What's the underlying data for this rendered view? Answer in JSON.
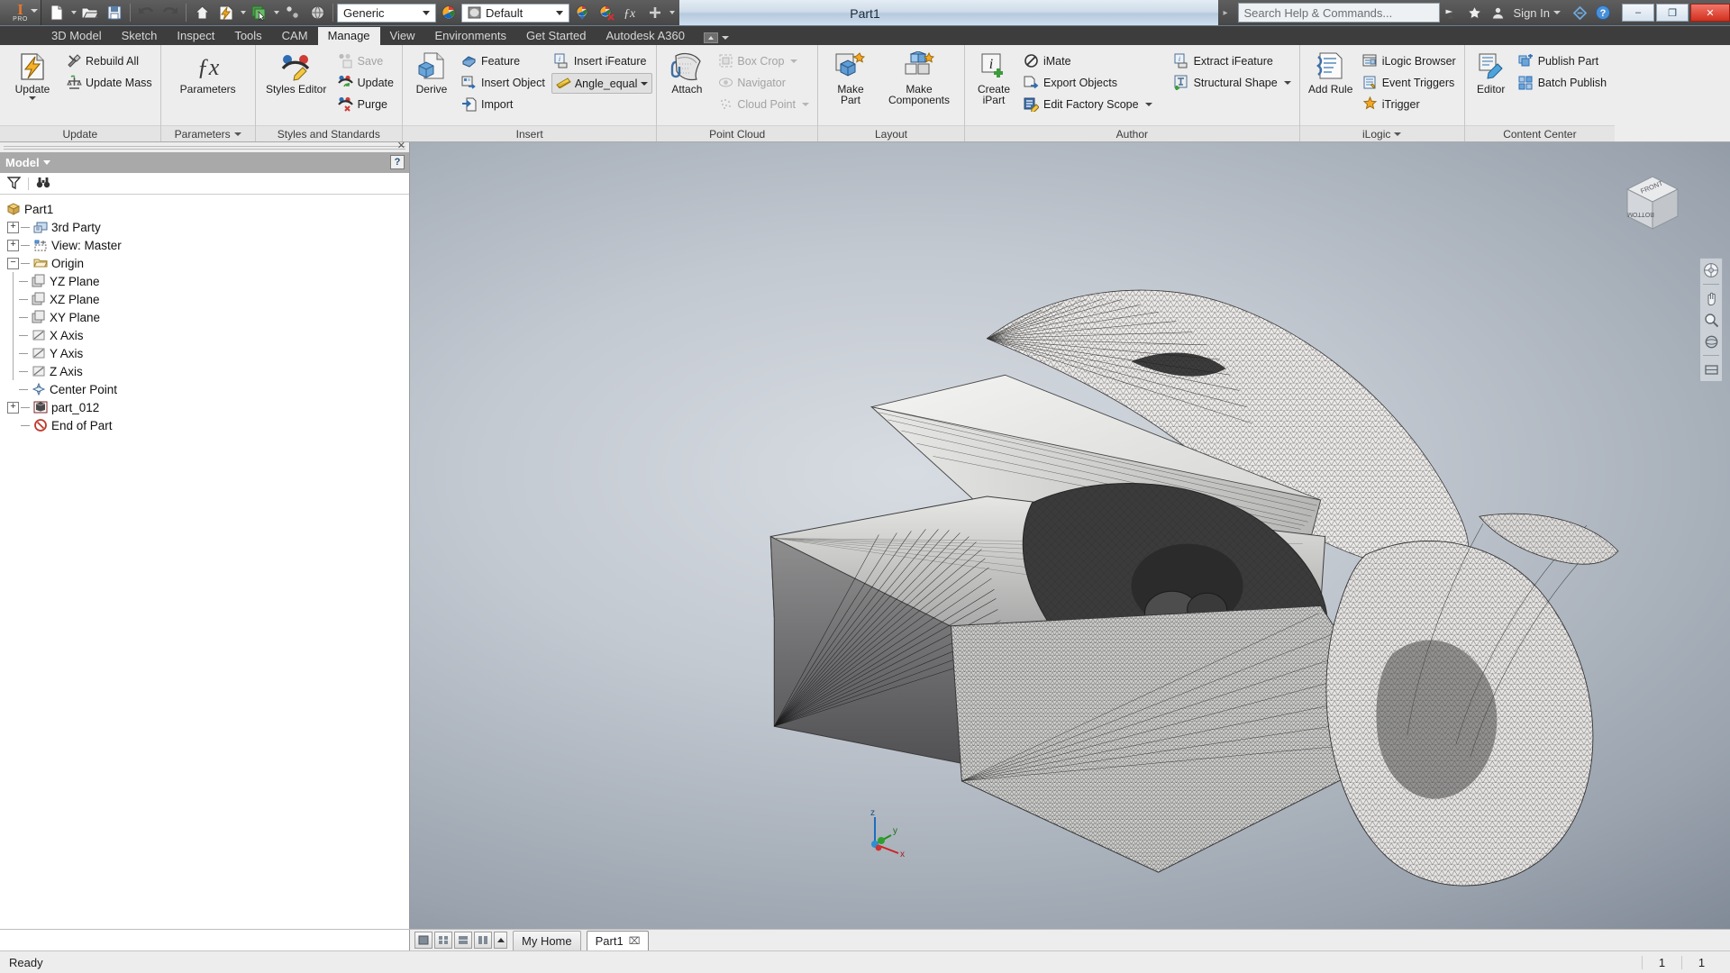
{
  "app": {
    "logo_text": "I",
    "logo_sub": "PRO",
    "title": "Part1"
  },
  "quick_access": {
    "items": [
      {
        "name": "new-document-button",
        "icon": "new-file-icon",
        "caret": true
      },
      {
        "name": "open-document-button",
        "icon": "open-folder-icon",
        "caret": false
      },
      {
        "name": "save-document-button",
        "icon": "floppy-save-icon",
        "caret": false
      },
      {
        "name": "undo-button",
        "icon": "undo-arrow-icon",
        "caret": false
      },
      {
        "name": "redo-button",
        "icon": "redo-arrow-icon",
        "caret": false
      },
      {
        "name": "home-button",
        "icon": "home-icon",
        "caret": false
      },
      {
        "name": "update-button",
        "icon": "lightning-update-icon",
        "caret": true
      },
      {
        "name": "select-button",
        "icon": "select-green-icon",
        "caret": true
      },
      {
        "name": "return-button",
        "icon": "return-node-icon",
        "caret": false
      },
      {
        "name": "appearance-sphere-button",
        "icon": "globe-sphere-icon",
        "caret": false
      }
    ],
    "material_combo": "Generic",
    "appearance_combo": "Default",
    "extra": [
      {
        "name": "adjust-appearance-button",
        "icon": "appearance-adjust-icon"
      },
      {
        "name": "clear-appearance-button",
        "icon": "appearance-clear-icon"
      },
      {
        "name": "parameters-fx-button",
        "icon": "fx-icon"
      },
      {
        "name": "customize-qat-button",
        "icon": "plus-icon",
        "caret": true
      }
    ]
  },
  "titlebar_right": {
    "search_placeholder": "Search Help & Commands...",
    "signin_label": "Sign In",
    "icons": [
      {
        "name": "autodesk-exchange-icon"
      },
      {
        "name": "favorites-star-icon"
      },
      {
        "name": "user-account-icon"
      },
      {
        "name": "exchange-apps-icon"
      },
      {
        "name": "help-question-icon"
      }
    ],
    "window_controls": {
      "minimize": "–",
      "maximize": "❐",
      "close": "✕"
    }
  },
  "ribbon_tabs": {
    "items": [
      {
        "label": "3D Model",
        "active": false
      },
      {
        "label": "Sketch",
        "active": false
      },
      {
        "label": "Inspect",
        "active": false
      },
      {
        "label": "Tools",
        "active": false
      },
      {
        "label": "CAM",
        "active": false
      },
      {
        "label": "Manage",
        "active": true
      },
      {
        "label": "View",
        "active": false
      },
      {
        "label": "Environments",
        "active": false
      },
      {
        "label": "Get Started",
        "active": false
      },
      {
        "label": "Autodesk A360",
        "active": false
      }
    ]
  },
  "ribbon_panels": [
    {
      "title": "Update",
      "has_caret": false,
      "big_buttons": [
        {
          "label_line1": "Update",
          "label_line2": "",
          "icon": "update-lightning-icon",
          "has_dropdown": true
        }
      ],
      "small_buttons": [
        {
          "label": "Rebuild All",
          "icon": "rebuild-tools-icon",
          "disabled": false,
          "caret": false
        },
        {
          "label": "Update Mass",
          "icon": "update-mass-scale-icon",
          "disabled": false,
          "caret": false
        }
      ]
    },
    {
      "title": "Parameters",
      "has_caret": true,
      "big_buttons": [
        {
          "label_line1": "Parameters",
          "label_line2": "",
          "icon": "fx-parameters-icon",
          "has_dropdown": false
        }
      ],
      "small_buttons": []
    },
    {
      "title": "Styles and Standards",
      "has_caret": false,
      "big_buttons": [
        {
          "label_line1": "Styles Editor",
          "label_line2": "",
          "icon": "styles-editor-icon",
          "has_dropdown": false
        }
      ],
      "small_buttons": [
        {
          "label": "Save",
          "icon": "styles-save-icon",
          "disabled": true,
          "caret": false
        },
        {
          "label": "Update",
          "icon": "styles-update-icon",
          "disabled": false,
          "caret": false
        },
        {
          "label": "Purge",
          "icon": "styles-purge-icon",
          "disabled": false,
          "caret": false
        }
      ]
    },
    {
      "title": "Insert",
      "has_caret": false,
      "big_buttons": [
        {
          "label_line1": "Derive",
          "label_line2": "",
          "icon": "derive-part-icon",
          "has_dropdown": false
        }
      ],
      "small_buttons": [
        {
          "label": "Feature",
          "icon": "feature-icon",
          "disabled": false,
          "caret": false
        },
        {
          "label": "Insert Object",
          "icon": "insert-object-icon",
          "disabled": false,
          "caret": false
        },
        {
          "label": "Import",
          "icon": "import-arrow-icon",
          "disabled": false,
          "caret": false
        }
      ],
      "small_buttons2": [
        {
          "label": "Insert iFeature",
          "icon": "insert-ifeature-icon",
          "disabled": false,
          "caret": false
        }
      ],
      "combo": {
        "label": "Angle_equal",
        "icon": "angle-equal-icon"
      }
    },
    {
      "title": "Point Cloud",
      "has_caret": false,
      "big_buttons": [
        {
          "label_line1": "Attach",
          "label_line2": "",
          "icon": "attach-pointcloud-icon",
          "has_dropdown": false
        }
      ],
      "small_buttons": [
        {
          "label": "Box Crop",
          "icon": "box-crop-icon",
          "disabled": true,
          "caret": true
        },
        {
          "label": "Navigator",
          "icon": "navigator-icon",
          "disabled": true,
          "caret": false
        },
        {
          "label": "Cloud Point",
          "icon": "cloud-point-icon",
          "disabled": true,
          "caret": true
        }
      ]
    },
    {
      "title": "Layout",
      "has_caret": false,
      "big_buttons": [
        {
          "label_line1": "Make",
          "label_line2": "Part",
          "icon": "make-part-icon",
          "has_dropdown": false
        },
        {
          "label_line1": "Make",
          "label_line2": "Components",
          "icon": "make-components-icon",
          "has_dropdown": false
        }
      ],
      "small_buttons": []
    },
    {
      "title": "Author",
      "has_caret": false,
      "big_buttons": [
        {
          "label_line1": "Create",
          "label_line2": "iPart",
          "icon": "create-ipart-icon",
          "has_dropdown": false
        }
      ],
      "small_buttons": [
        {
          "label": "iMate",
          "icon": "imate-icon",
          "disabled": false,
          "caret": false
        },
        {
          "label": "Export Objects",
          "icon": "export-objects-icon",
          "disabled": false,
          "caret": false
        },
        {
          "label": "Edit Factory Scope",
          "icon": "edit-factory-scope-icon",
          "disabled": false,
          "caret": true
        }
      ],
      "small_buttons2": [
        {
          "label": "Extract iFeature",
          "icon": "extract-ifeature-icon",
          "disabled": false,
          "caret": false
        },
        {
          "label": "Structural Shape",
          "icon": "structural-shape-icon",
          "disabled": false,
          "caret": true
        }
      ]
    },
    {
      "title": "iLogic",
      "has_caret": true,
      "big_buttons": [
        {
          "label_line1": "Add Rule",
          "label_line2": "",
          "icon": "add-rule-icon",
          "has_dropdown": false
        }
      ],
      "small_buttons": [
        {
          "label": "iLogic Browser",
          "icon": "ilogic-browser-icon",
          "disabled": false,
          "caret": false
        },
        {
          "label": "Event Triggers",
          "icon": "event-triggers-icon",
          "disabled": false,
          "caret": false
        },
        {
          "label": "iTrigger",
          "icon": "itrigger-icon",
          "disabled": false,
          "caret": false
        }
      ]
    },
    {
      "title": "Content Center",
      "has_caret": false,
      "big_buttons": [
        {
          "label_line1": "Editor",
          "label_line2": "",
          "icon": "content-editor-icon",
          "has_dropdown": false
        }
      ],
      "small_buttons": [
        {
          "label": "Publish Part",
          "icon": "publish-part-icon",
          "disabled": false,
          "caret": false
        },
        {
          "label": "Batch Publish",
          "icon": "batch-publish-icon",
          "disabled": false,
          "caret": false
        }
      ]
    }
  ],
  "browser": {
    "panel_title": "Model",
    "help_glyph": "?",
    "filter_icon": "filter-funnel-icon",
    "find_icon": "binoculars-find-icon",
    "tree": [
      {
        "label": "Part1",
        "depth": 0,
        "expander": "none",
        "icon": "part-cube-icon"
      },
      {
        "label": "3rd Party",
        "depth": 1,
        "expander": "plus",
        "icon": "third-party-icon"
      },
      {
        "label": "View: Master",
        "depth": 1,
        "expander": "plus",
        "icon": "view-master-icon"
      },
      {
        "label": "Origin",
        "depth": 1,
        "expander": "minus",
        "icon": "folder-icon"
      },
      {
        "label": "YZ Plane",
        "depth": 2,
        "expander": "leaf",
        "icon": "plane-icon"
      },
      {
        "label": "XZ Plane",
        "depth": 2,
        "expander": "leaf",
        "icon": "plane-icon"
      },
      {
        "label": "XY Plane",
        "depth": 2,
        "expander": "leaf",
        "icon": "plane-icon"
      },
      {
        "label": "X Axis",
        "depth": 2,
        "expander": "leaf",
        "icon": "axis-icon"
      },
      {
        "label": "Y Axis",
        "depth": 2,
        "expander": "leaf",
        "icon": "axis-icon"
      },
      {
        "label": "Z Axis",
        "depth": 2,
        "expander": "leaf",
        "icon": "axis-icon"
      },
      {
        "label": "Center Point",
        "depth": 2,
        "expander": "leaf",
        "icon": "center-point-icon"
      },
      {
        "label": "part_012",
        "depth": 1,
        "expander": "plus",
        "icon": "solid-body-icon"
      },
      {
        "label": "End of Part",
        "depth": 1,
        "expander": "none",
        "icon": "end-of-part-icon"
      }
    ]
  },
  "canvas": {
    "viewcube": {
      "top_face": "FRONT",
      "bottom_face": "BOTTOM"
    },
    "axis_labels": {
      "x": "x",
      "y": "y",
      "z": "z"
    },
    "nav_icons": [
      {
        "name": "full-navigation-wheel-icon"
      },
      {
        "name": "pan-hand-icon"
      },
      {
        "name": "zoom-magnifier-icon"
      },
      {
        "name": "orbit-icon"
      },
      {
        "name": "look-at-icon"
      }
    ]
  },
  "doc_tabs": {
    "view_toggles": [
      {
        "name": "single-view-toggle",
        "selected": false
      },
      {
        "name": "grid-view-toggle",
        "selected": false
      },
      {
        "name": "horizontal-split-toggle",
        "selected": false
      },
      {
        "name": "vertical-split-toggle",
        "selected": false
      }
    ],
    "tabs": [
      {
        "label": "My Home",
        "closable": false,
        "active": false
      },
      {
        "label": "Part1",
        "closable": true,
        "active": true
      }
    ],
    "close_glyph": "⌧"
  },
  "status_bar": {
    "message": "Ready",
    "cell_1": "1",
    "cell_2": "1"
  },
  "colors": {
    "accent_orange": "#e8762c",
    "ribbon_bg": "#ededed",
    "tab_bar_bg": "#3d3d3d",
    "browser_header": "#a9a9a9",
    "close_red": "#d22f1e"
  }
}
